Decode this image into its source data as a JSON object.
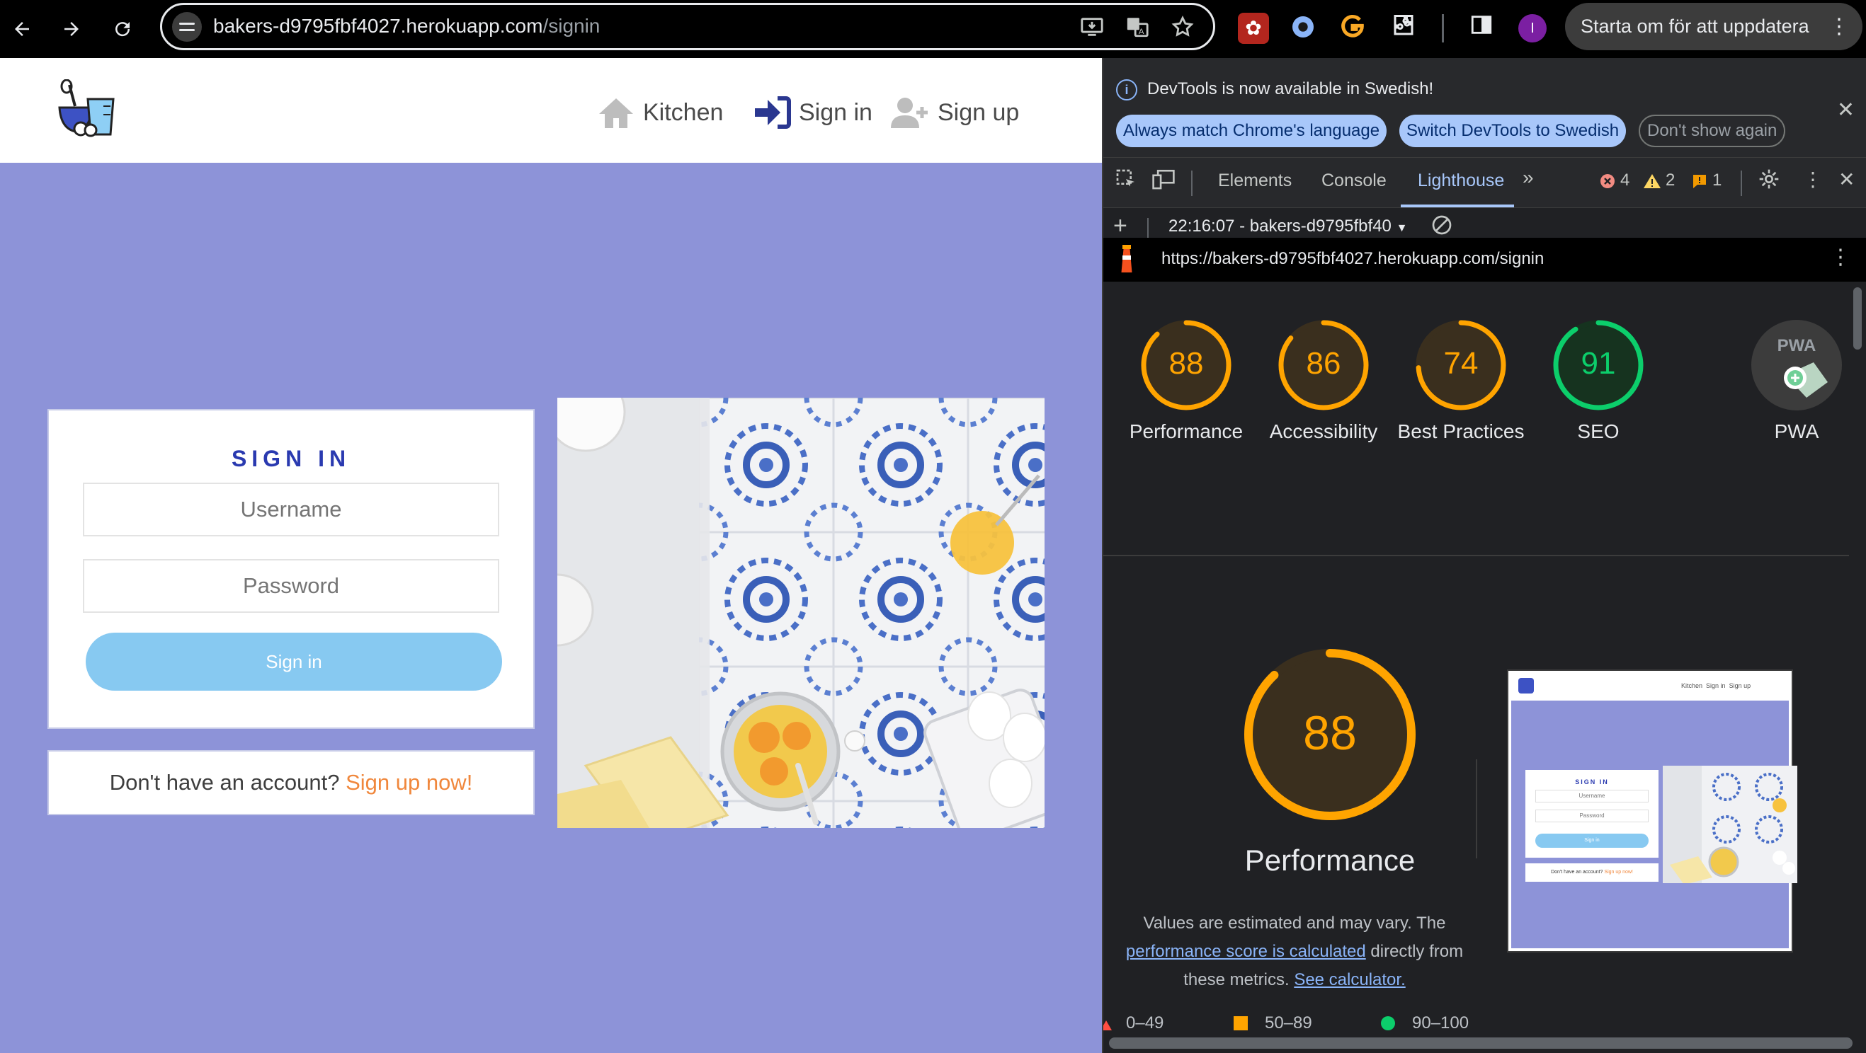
{
  "browser": {
    "url_host": "bakers-d9795fbf4027.herokuapp.com",
    "url_path": "/signin",
    "profile_initial": "I",
    "update_label": "Starta om för att uppdatera"
  },
  "site": {
    "nav": {
      "kitchen": "Kitchen",
      "signin": "Sign in",
      "signup": "Sign up"
    },
    "signin_card": {
      "title": "SIGN IN",
      "username_placeholder": "Username",
      "password_placeholder": "Password",
      "button": "Sign in"
    },
    "account_prompt": "Don't have an account?",
    "signup_link": "Sign up now!"
  },
  "devtools": {
    "lang_message": "DevTools is now available in Swedish!",
    "lang_btn_match": "Always match Chrome's language",
    "lang_btn_switch": "Switch DevTools to Swedish",
    "lang_btn_dismiss": "Don't show again",
    "tabs": {
      "elements": "Elements",
      "console": "Console",
      "lighthouse": "Lighthouse"
    },
    "counts": {
      "errors": "4",
      "warnings": "2",
      "issues": "1"
    },
    "report_selector": "22:16:07 - bakers-d9795fbf40",
    "report_url": "https://bakers-d9795fbf4027.herokuapp.com/signin",
    "scores": [
      {
        "label": "Performance",
        "value": 88,
        "color": "#ffa400"
      },
      {
        "label": "Accessibility",
        "value": 86,
        "color": "#ffa400"
      },
      {
        "label": "Best Practices",
        "value": 74,
        "color": "#ffa400"
      },
      {
        "label": "SEO",
        "value": 91,
        "color": "#0cce6b"
      }
    ],
    "pwa_label": "PWA",
    "pwa_badge": "PWA",
    "big": {
      "value": "88",
      "label": "Performance"
    },
    "note_pre": "Values are estimated and may vary. The",
    "note_link1": "performance score is calculated",
    "note_mid": "directly from these metrics.",
    "note_link2": "See calculator.",
    "legend": {
      "red": "0–49",
      "orange": "50–89",
      "green": "90–100"
    },
    "thumb": {
      "nav_kitchen": "Kitchen",
      "nav_signin": "Sign in",
      "nav_signup": "Sign up",
      "title": "SIGN IN",
      "username": "Username",
      "password": "Password",
      "button": "Sign in",
      "prompt": "Don't have an account?",
      "link": "Sign up now!"
    }
  }
}
